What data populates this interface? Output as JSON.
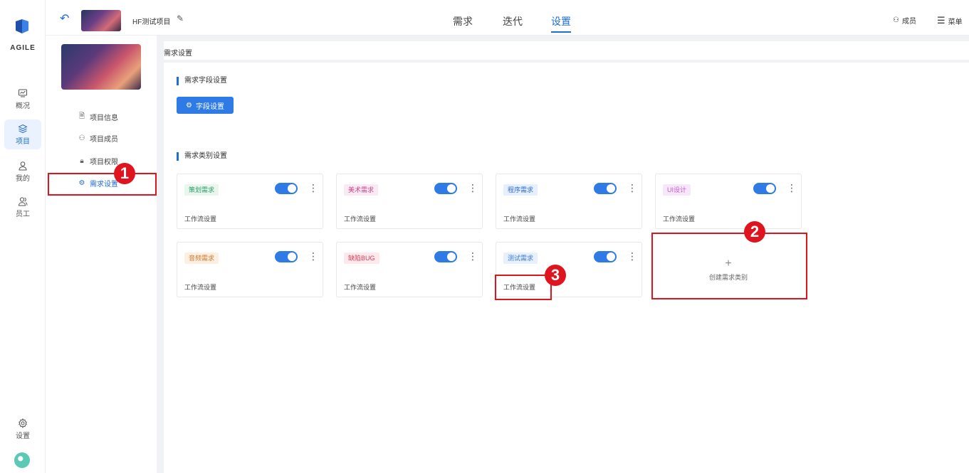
{
  "app": {
    "logo_text": "AGILE"
  },
  "rail": {
    "items": [
      {
        "label": "概况",
        "icon": "overview-icon"
      },
      {
        "label": "项目",
        "icon": "project-icon"
      },
      {
        "label": "我的",
        "icon": "user-icon"
      },
      {
        "label": "员工",
        "icon": "staff-icon"
      }
    ],
    "settings_label": "设置"
  },
  "header": {
    "project_name": "HF测试项目",
    "tabs": [
      "需求",
      "迭代",
      "设置"
    ],
    "active_tab": "设置",
    "members_label": "成员",
    "menu_label": "菜单"
  },
  "sidebar": {
    "items": [
      {
        "label": "项目信息",
        "icon": "document-icon"
      },
      {
        "label": "项目成员",
        "icon": "members-icon"
      },
      {
        "label": "项目权限",
        "icon": "lock-icon"
      },
      {
        "label": "需求设置",
        "icon": "gear-icon"
      }
    ],
    "active": "需求设置"
  },
  "breadcrumb": "需求设置",
  "field_section": {
    "title": "需求字段设置",
    "button_label": "字段设置"
  },
  "type_section": {
    "title": "需求类别设置",
    "cards": [
      {
        "tag": "策划需求",
        "tag_color": "#2e9e6b",
        "tag_bg": "#e8f6ee",
        "enabled": true,
        "workflow": "工作流设置"
      },
      {
        "tag": "美术需求",
        "tag_color": "#c04b8e",
        "tag_bg": "#fbe9f3",
        "enabled": true,
        "workflow": "工作流设置"
      },
      {
        "tag": "程序需求",
        "tag_color": "#2f6fd0",
        "tag_bg": "#e6efff",
        "enabled": true,
        "workflow": "工作流设置"
      },
      {
        "tag": "UI设计",
        "tag_color": "#c25bd0",
        "tag_bg": "#f7e7fa",
        "enabled": true,
        "workflow": "工作流设置"
      },
      {
        "tag": "音频需求",
        "tag_color": "#d2782d",
        "tag_bg": "#fdf0e3",
        "enabled": true,
        "workflow": "工作流设置"
      },
      {
        "tag": "缺陷BUG",
        "tag_color": "#d6415b",
        "tag_bg": "#fde8ec",
        "enabled": true,
        "workflow": "工作流设置"
      },
      {
        "tag": "测试需求",
        "tag_color": "#3a7bd5",
        "tag_bg": "#e8f0fd",
        "enabled": true,
        "workflow": "工作流设置"
      }
    ],
    "create_label": "创建需求类别"
  },
  "annotations": [
    "1",
    "2",
    "3"
  ],
  "colors": {
    "accent": "#1f6ed4",
    "highlight": "#e0141e"
  }
}
